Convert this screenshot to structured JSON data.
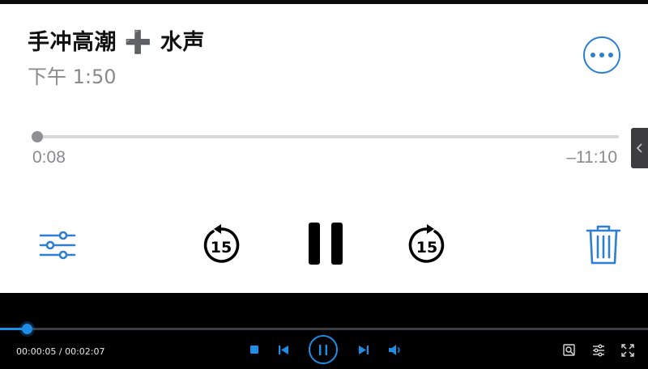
{
  "recording": {
    "title": "手冲高潮 ➕ 水声",
    "time": "下午 1:50",
    "elapsed": "0:08",
    "remaining": "–11:10",
    "progress_fraction": 0.0
  },
  "player": {
    "time_readout": "00:00:05 / 00:02:07",
    "progress_fraction": 0.039,
    "state": "playing"
  },
  "icons": {
    "more": "more-options-icon",
    "settings": "sliders-icon",
    "skip_back": "skip-back-15-icon",
    "pause": "pause-icon",
    "skip_forward": "skip-forward-15-icon",
    "trash": "trash-icon",
    "side_tab": "chevron-left-icon",
    "stop": "stop-icon",
    "prev": "previous-track-icon",
    "play_pause": "pause-icon",
    "next": "next-track-icon",
    "volume": "volume-icon",
    "screenshot": "screenshot-icon",
    "adjust": "adjust-icon",
    "fullscreen": "fullscreen-icon"
  },
  "skip_seconds_label": "15",
  "colors": {
    "accent_ios": "#2f7fd1",
    "accent_player": "#1e8de6",
    "text_primary": "#111111",
    "text_secondary": "#8a8a8e"
  }
}
